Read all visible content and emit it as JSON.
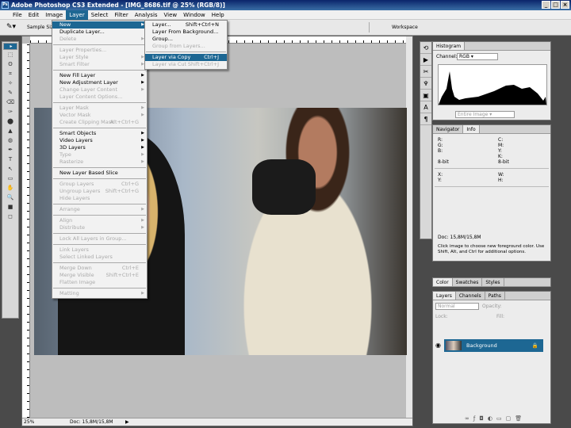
{
  "title": "Adobe Photoshop CS3 Extended - [IMG_8686.tif @ 25% (RGB/8)]",
  "menubar": [
    "File",
    "Edit",
    "Image",
    "Layer",
    "Select",
    "Filter",
    "Analysis",
    "View",
    "Window",
    "Help"
  ],
  "active_menu": "Layer",
  "options": {
    "sample_size": "Sample Size",
    "workspace": "Workspace"
  },
  "layer_menu": [
    {
      "label": "New",
      "sub": true
    },
    {
      "label": "Duplicate Layer..."
    },
    {
      "label": "Delete",
      "sub": true,
      "dis": true
    },
    {
      "sep": true
    },
    {
      "label": "Layer Properties...",
      "dis": true
    },
    {
      "label": "Layer Style",
      "sub": true,
      "dis": true
    },
    {
      "label": "Smart Filter",
      "sub": true,
      "dis": true
    },
    {
      "sep": true
    },
    {
      "label": "New Fill Layer",
      "sub": true
    },
    {
      "label": "New Adjustment Layer",
      "sub": true
    },
    {
      "label": "Change Layer Content",
      "sub": true,
      "dis": true
    },
    {
      "label": "Layer Content Options...",
      "dis": true
    },
    {
      "sep": true
    },
    {
      "label": "Layer Mask",
      "sub": true,
      "dis": true
    },
    {
      "label": "Vector Mask",
      "sub": true,
      "dis": true
    },
    {
      "label": "Create Clipping Mask",
      "sc": "Alt+Ctrl+G",
      "dis": true
    },
    {
      "sep": true
    },
    {
      "label": "Smart Objects",
      "sub": true
    },
    {
      "label": "Video Layers",
      "sub": true
    },
    {
      "label": "3D Layers",
      "sub": true
    },
    {
      "label": "Type",
      "sub": true,
      "dis": true
    },
    {
      "label": "Rasterize",
      "sub": true,
      "dis": true
    },
    {
      "sep": true
    },
    {
      "label": "New Layer Based Slice"
    },
    {
      "sep": true
    },
    {
      "label": "Group Layers",
      "sc": "Ctrl+G",
      "dis": true
    },
    {
      "label": "Ungroup Layers",
      "sc": "Shift+Ctrl+G",
      "dis": true
    },
    {
      "label": "Hide Layers",
      "dis": true
    },
    {
      "sep": true
    },
    {
      "label": "Arrange",
      "sub": true,
      "dis": true
    },
    {
      "sep": true
    },
    {
      "label": "Align",
      "sub": true,
      "dis": true
    },
    {
      "label": "Distribute",
      "sub": true,
      "dis": true
    },
    {
      "sep": true
    },
    {
      "label": "Lock All Layers in Group...",
      "dis": true
    },
    {
      "sep": true
    },
    {
      "label": "Link Layers",
      "dis": true
    },
    {
      "label": "Select Linked Layers",
      "dis": true
    },
    {
      "sep": true
    },
    {
      "label": "Merge Down",
      "sc": "Ctrl+E",
      "dis": true
    },
    {
      "label": "Merge Visible",
      "sc": "Shift+Ctrl+E",
      "dis": true
    },
    {
      "label": "Flatten Image",
      "dis": true
    },
    {
      "sep": true
    },
    {
      "label": "Matting",
      "sub": true,
      "dis": true
    }
  ],
  "new_submenu": [
    {
      "label": "Layer...",
      "sc": "Shift+Ctrl+N"
    },
    {
      "label": "Layer From Background..."
    },
    {
      "label": "Group..."
    },
    {
      "label": "Group from Layers...",
      "dis": true
    },
    {
      "sep": true
    },
    {
      "label": "Layer via Copy",
      "sc": "Ctrl+J",
      "hl": true
    },
    {
      "label": "Layer via Cut",
      "sc": "Shift+Ctrl+J",
      "dis": true
    }
  ],
  "status": {
    "zoom": "25%",
    "doc": "Doc: 15,8M/15,8M"
  },
  "histogram": {
    "tab": "Histogram",
    "channel_label": "Channel:",
    "channel": "RGB",
    "source": "Entire Image"
  },
  "info": {
    "tabs": [
      "Navigator",
      "Info"
    ],
    "rows": [
      [
        "R:",
        "C:"
      ],
      [
        "G:",
        "M:"
      ],
      [
        "B:",
        "Y:"
      ],
      [
        "",
        "K:"
      ],
      [
        "8-bit",
        "8-bit"
      ],
      [
        "X:",
        "W:"
      ],
      [
        "Y:",
        "H:"
      ]
    ],
    "doc": "Doc: 15,8M/15,8M",
    "hint": "Click image to choose new foreground color. Use Shift, Alt, and Ctrl for additional options."
  },
  "swatches_tabs": [
    "Color",
    "Swatches",
    "Styles"
  ],
  "layers": {
    "tabs": [
      "Layers",
      "Channels",
      "Paths"
    ],
    "blend": "Normal",
    "opacity_label": "Opacity:",
    "lock_label": "Lock:",
    "fill_label": "Fill:",
    "layer_name": "Background"
  }
}
